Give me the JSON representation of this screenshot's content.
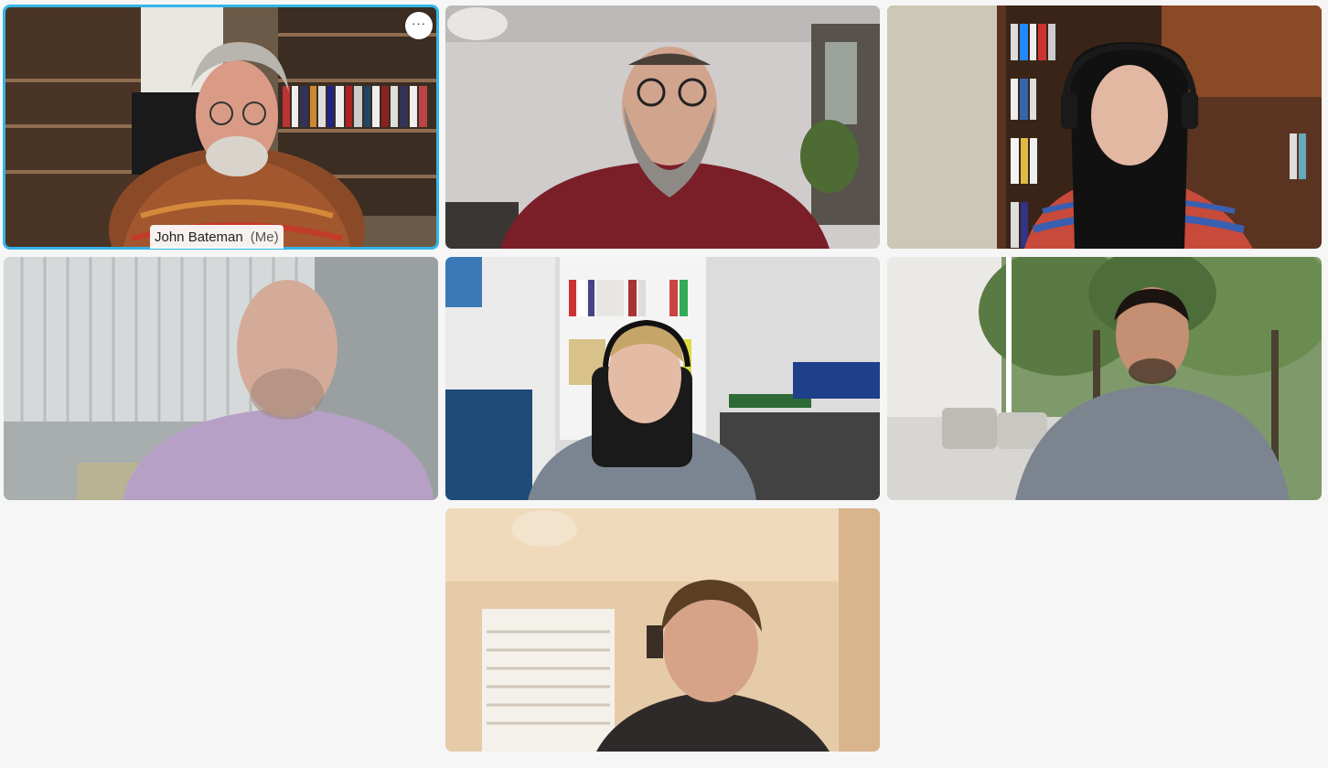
{
  "gallery": {
    "participants": [
      {
        "name": "John Bateman",
        "self_label": "(Me)",
        "active": true
      },
      {
        "name": ""
      },
      {
        "name": ""
      },
      {
        "name": ""
      },
      {
        "name": ""
      },
      {
        "name": ""
      },
      {
        "name": ""
      }
    ],
    "more_button_label": "···",
    "accent_color": "#33b5e8"
  }
}
